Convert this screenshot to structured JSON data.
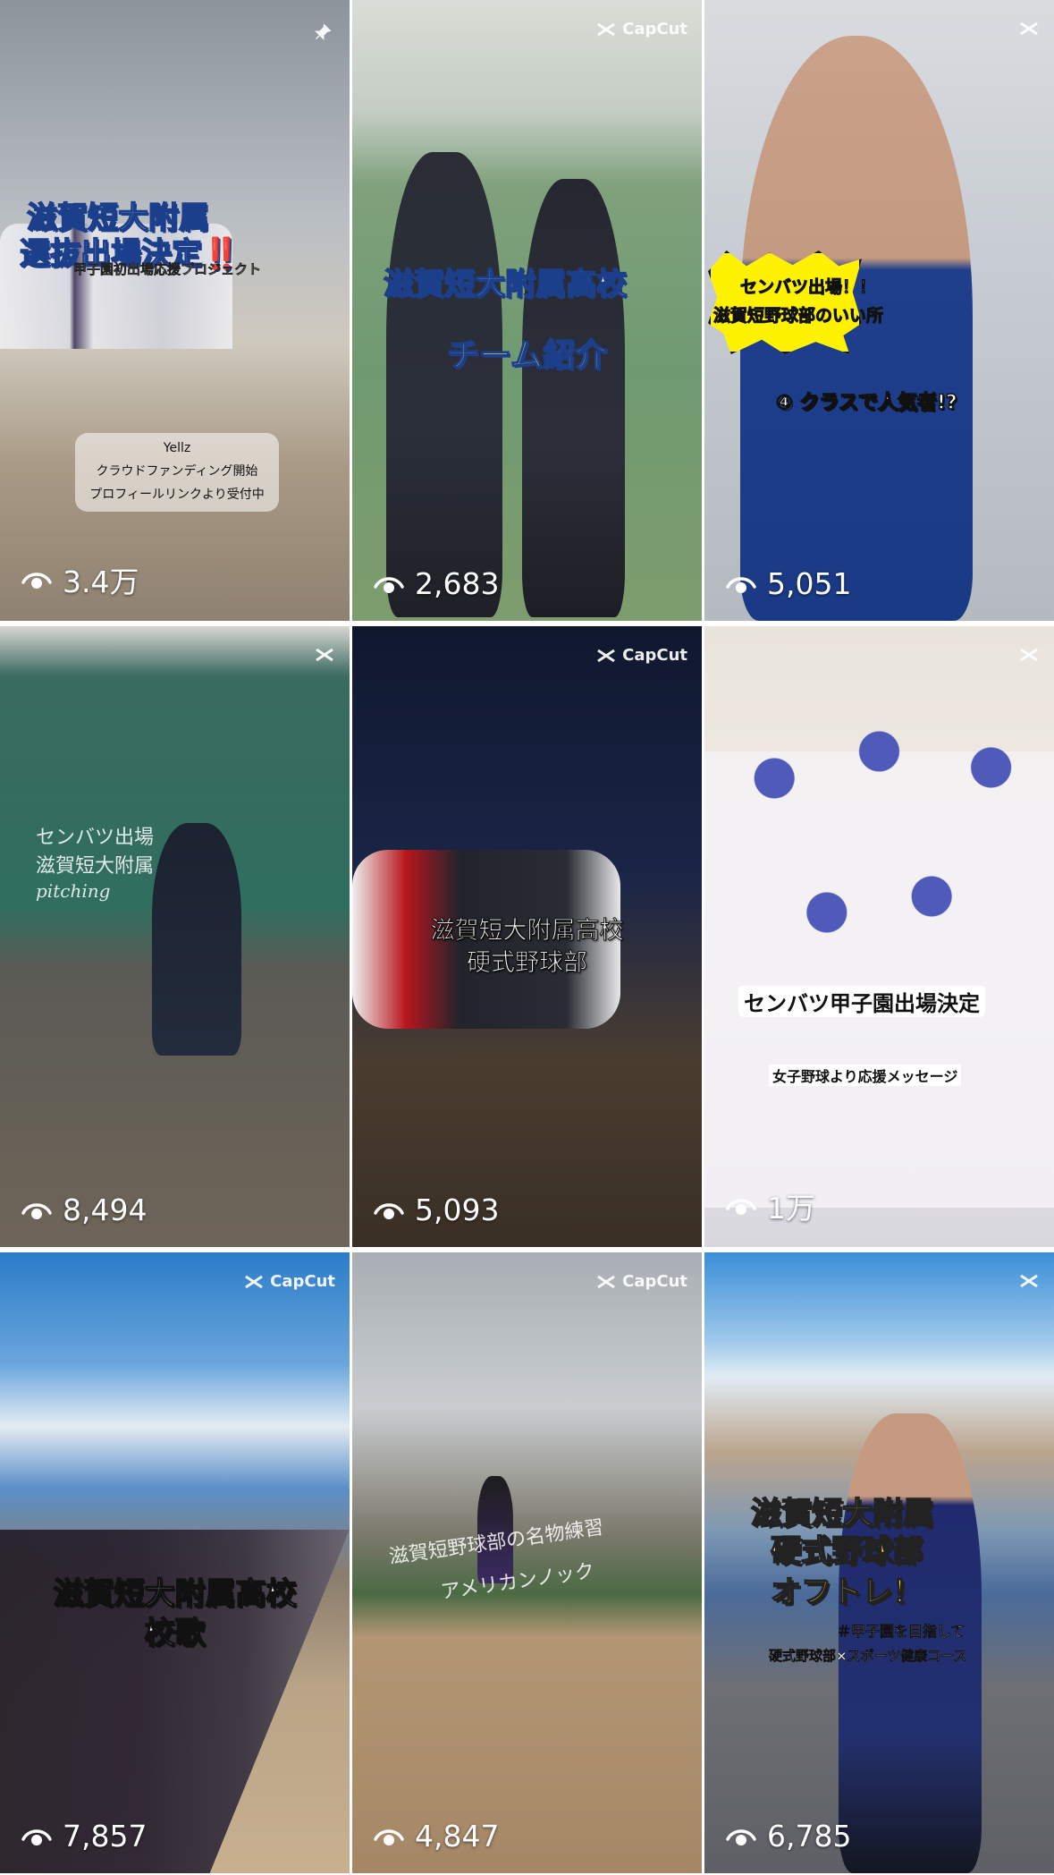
{
  "grid": {
    "tiles": [
      {
        "views": "3.4万",
        "badge": "pin-icon",
        "captions": {
          "line1": "滋賀短大附属",
          "line2a": "選抜出場決定",
          "line2b": "‼️",
          "line3": "甲子園初出場応援プロジェクト",
          "box1": "Yellz",
          "box2": "クラウドファンディング開始",
          "box3": "プロフィールリンクより受付中"
        }
      },
      {
        "views": "2,683",
        "badge": "CapCut",
        "captions": {
          "line1": "滋賀短大附属高校",
          "line2": "チーム紹介"
        }
      },
      {
        "views": "5,051",
        "badge": "capcut-icon",
        "captions": {
          "burst1": "センバツ出場！！",
          "burst2": "滋賀短野球部のいい所",
          "line": "④ クラスで人気者!?"
        }
      },
      {
        "views": "8,494",
        "badge": "capcut-icon",
        "captions": {
          "line1": "センバツ出場",
          "line2": "滋賀短大附属",
          "line3": "pitching"
        }
      },
      {
        "views": "5,093",
        "badge": "CapCut",
        "captions": {
          "line1": "滋賀短大附属高校",
          "line2": "硬式野球部"
        }
      },
      {
        "views": "1万",
        "badge": "capcut-icon",
        "captions": {
          "line1": "センバツ甲子園出場決定",
          "line2": "女子野球より応援メッセージ"
        }
      },
      {
        "views": "7,857",
        "badge": "CapCut",
        "captions": {
          "line1": "滋賀短大附属高校",
          "line2": "校歌"
        }
      },
      {
        "views": "4,847",
        "badge": "CapCut",
        "captions": {
          "line1": "滋賀短野球部の名物練習",
          "line2": "アメリカンノック"
        }
      },
      {
        "views": "6,785",
        "badge": "capcut-icon",
        "captions": {
          "line1": "滋賀短大附属",
          "line2": "硬式野球部",
          "line3": "オフトレ！",
          "line4": "＃甲子園を目指して",
          "line5": "硬式野球部×スポーツ健康コース"
        }
      }
    ]
  },
  "colors": {
    "caption_blue": "#1c3f8c",
    "caption_yellow": "#ffe04a",
    "burst_yellow": "#fff200"
  }
}
